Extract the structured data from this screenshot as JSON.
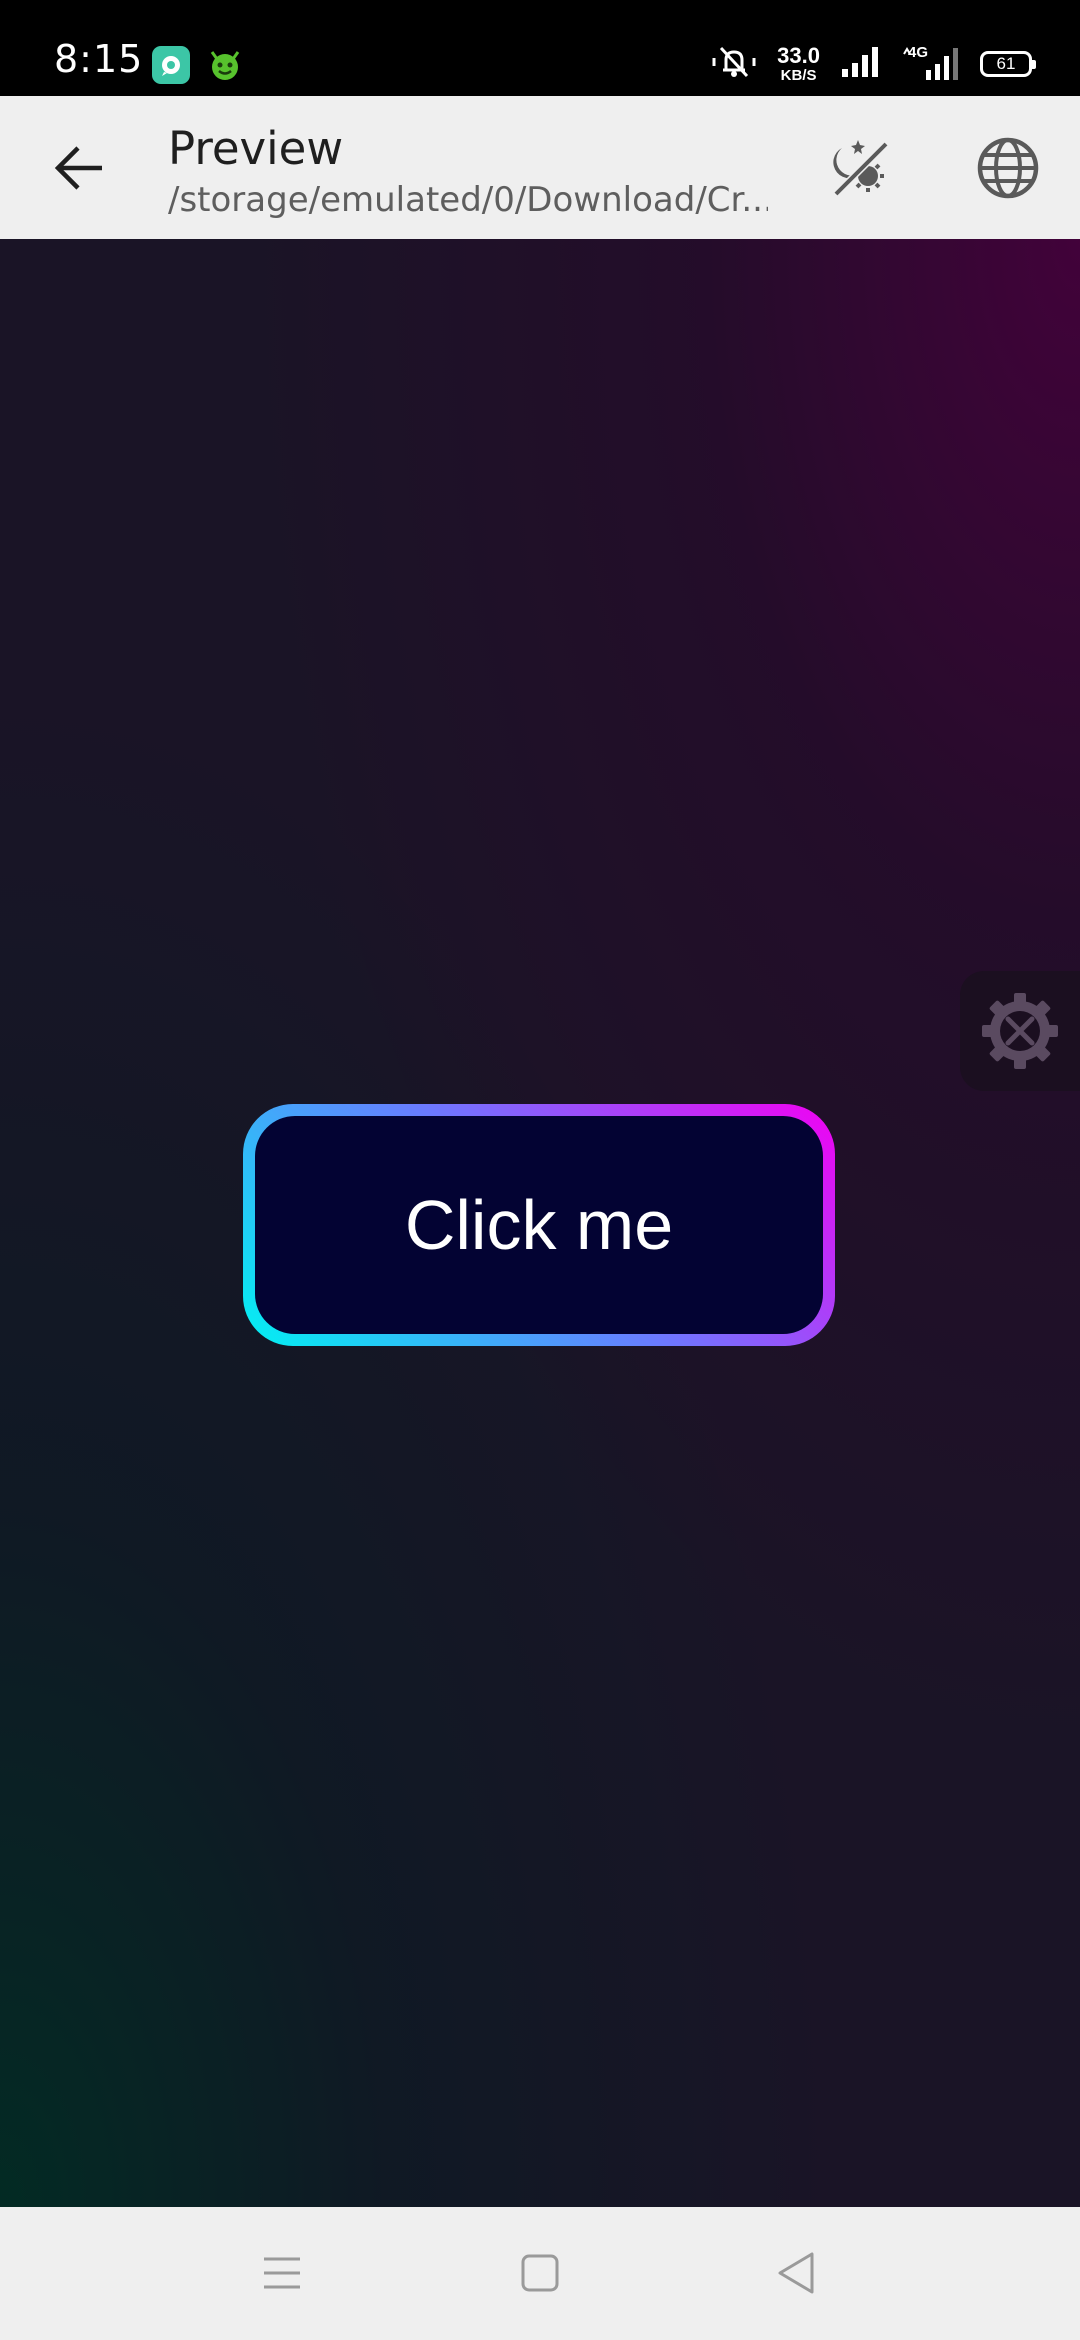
{
  "status_bar": {
    "time": "8:15",
    "notifications": [
      "chat-app-icon",
      "android-app-icon"
    ],
    "net_speed_value": "33.0",
    "net_speed_unit": "KB/S",
    "signal_label": "4G",
    "battery": "61"
  },
  "app_bar": {
    "title": "Preview",
    "subtitle": "/storage/emulated/0/Download/Cr...",
    "icons": [
      "back-arrow-icon",
      "theme-toggle-icon",
      "globe-icon"
    ]
  },
  "preview": {
    "button_label": "Click me",
    "colors": {
      "gradient_start": "#00f2f2",
      "gradient_mid": "#6a7bff",
      "gradient_end": "#f200f2",
      "button_fill": "#030333"
    },
    "floating_icon": "settings-tools-icon"
  },
  "nav_bar": {
    "icons": [
      "menu-icon",
      "home-icon",
      "back-icon"
    ]
  }
}
